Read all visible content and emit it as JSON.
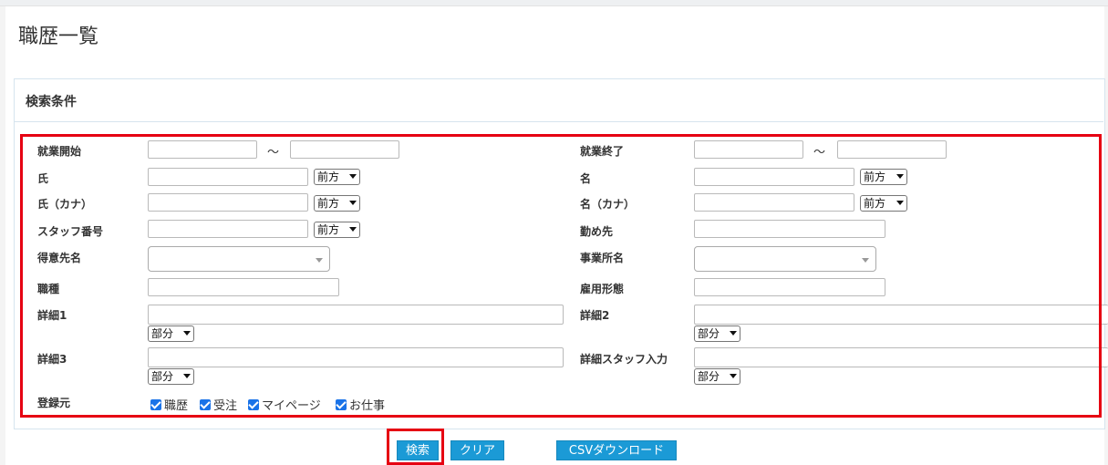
{
  "page": {
    "title": "職歴一覧"
  },
  "panel": {
    "title": "検索条件"
  },
  "fields": {
    "work_start": {
      "label": "就業開始",
      "tilde": "～"
    },
    "work_end": {
      "label": "就業終了",
      "tilde": "～"
    },
    "last_name": {
      "label": "氏",
      "match": "前方"
    },
    "first_name": {
      "label": "名",
      "match": "前方"
    },
    "last_name_kana": {
      "label": "氏（カナ）",
      "match": "前方"
    },
    "first_name_kana": {
      "label": "名（カナ）",
      "match": "前方"
    },
    "staff_number": {
      "label": "スタッフ番号",
      "match": "前方"
    },
    "workplace": {
      "label": "勤め先"
    },
    "client_name": {
      "label": "得意先名"
    },
    "office_name": {
      "label": "事業所名"
    },
    "job_type": {
      "label": "職種"
    },
    "employment_type": {
      "label": "雇用形態"
    },
    "detail1": {
      "label": "詳細1",
      "match": "部分"
    },
    "detail2": {
      "label": "詳細2",
      "match": "部分"
    },
    "detail3": {
      "label": "詳細3",
      "match": "部分"
    },
    "detail_staff_input": {
      "label": "詳細スタッフ入力",
      "match": "部分"
    },
    "source": {
      "label": "登録元",
      "options": [
        {
          "label": "職歴",
          "checked": true
        },
        {
          "label": "受注",
          "checked": true
        },
        {
          "label": "マイページ",
          "checked": true
        },
        {
          "label": "お仕事",
          "checked": true
        }
      ]
    }
  },
  "buttons": {
    "search": "検索",
    "clear": "クリア",
    "csv": "CSVダウンロード"
  },
  "colors": {
    "button": "#1b9ad6",
    "highlight": "#e60012",
    "checkbox": "#1a73e8"
  }
}
